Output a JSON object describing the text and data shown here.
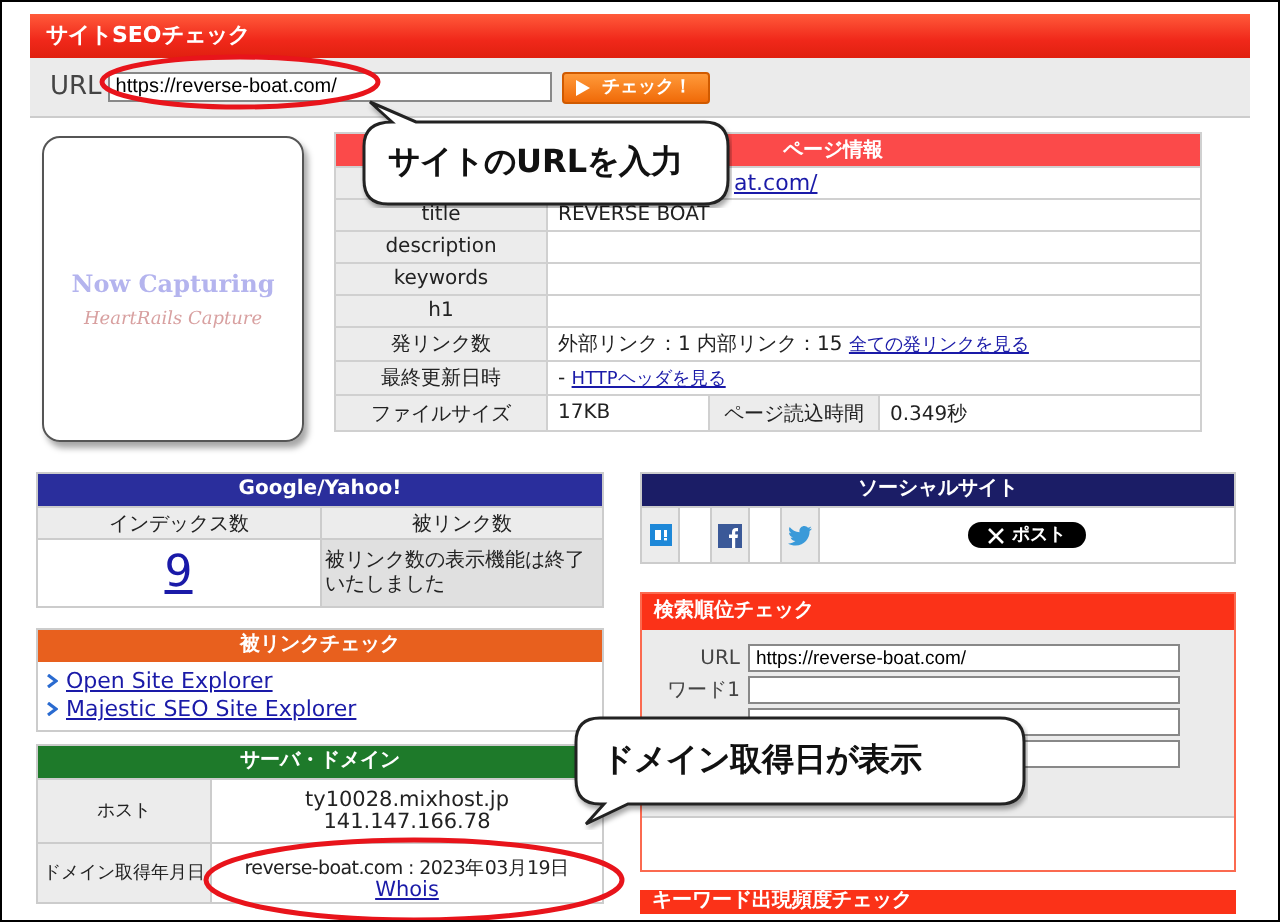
{
  "header": {
    "title": "サイトSEOチェック"
  },
  "url_form": {
    "label": "URL",
    "value": "https://reverse-boat.com/",
    "button": "チェック！"
  },
  "capture": {
    "title": "Now Capturing",
    "credit": "HeartRails Capture"
  },
  "page_info": {
    "title": "ページ情報",
    "rows": [
      {
        "kind": "link",
        "value": "at.com/"
      },
      {
        "kind": "text",
        "label": "title",
        "value": "REVERSE BOAT"
      },
      {
        "kind": "text",
        "label": "description"
      },
      {
        "kind": "text",
        "label": "keywords"
      },
      {
        "kind": "text",
        "label": "h1"
      },
      {
        "kind": "links",
        "label": "発リンク数",
        "value": "外部リンク：1 内部リンク：15",
        "link": "全ての発リンクを見る"
      },
      {
        "kind": "links",
        "label": "最終更新日時",
        "value": "-",
        "link": "HTTPヘッダを見る"
      },
      {
        "kind": "split",
        "label": "ファイルサイズ",
        "value": "17KB",
        "label2": "ページ読込時間",
        "value2": "0.349秒"
      }
    ]
  },
  "google": {
    "title": "Google/Yahoo!",
    "columns": [
      "インデックス数",
      "被リンク数"
    ],
    "index_count": "9",
    "backlink_note": "被リンク数の表示機能は終了いたしました"
  },
  "backlinks": {
    "title": "被リンクチェック",
    "links": [
      "Open Site Explorer",
      "Majestic SEO Site Explorer"
    ]
  },
  "server": {
    "title": "サーバ・ドメイン",
    "rows": [
      {
        "label": "ホスト",
        "lines": [
          "ty10028.mixhost.jp",
          "141.147.166.78"
        ]
      },
      {
        "label": "ドメイン取得年月日",
        "lines": [
          "reverse-boat.com : 2023年03月19日"
        ],
        "link": "Whois"
      }
    ]
  },
  "social": {
    "title": "ソーシャルサイト",
    "items": [
      {
        "kind": "bookmark"
      },
      {
        "kind": "facebook"
      },
      {
        "kind": "twitter",
        "button": "ポスト"
      }
    ]
  },
  "rank": {
    "title": "検索順位チェック",
    "fields": [
      {
        "kind": "input",
        "label": "URL",
        "value": "https://reverse-boat.com/"
      },
      {
        "kind": "input",
        "label": "ワード1"
      },
      {
        "kind": "input"
      },
      {
        "kind": "input"
      }
    ]
  },
  "keyword": {
    "title": "キーワード出現頻度チェック"
  },
  "callouts": [
    {
      "text": "サイトのURLを入力"
    },
    {
      "text": "ドメイン取得日が表示"
    }
  ]
}
